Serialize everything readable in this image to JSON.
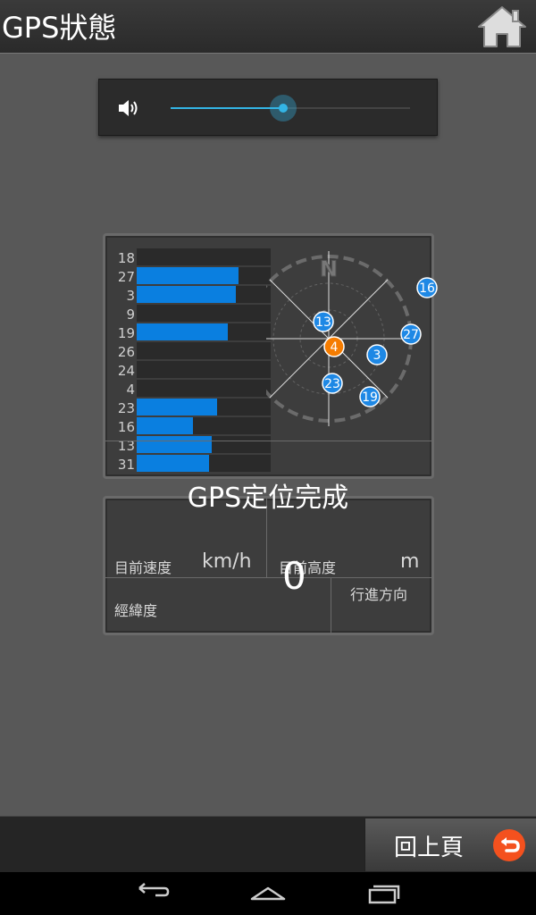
{
  "header": {
    "title": "GPS狀態",
    "home_icon": "home-icon"
  },
  "volume": {
    "level_percent": 47,
    "accent_color": "#33b5e5",
    "icon": "speaker-icon"
  },
  "satellites": {
    "bars": [
      {
        "id": "18",
        "strength": 0
      },
      {
        "id": "27",
        "strength": 76
      },
      {
        "id": "3",
        "strength": 74
      },
      {
        "id": "9",
        "strength": 0
      },
      {
        "id": "19",
        "strength": 68
      },
      {
        "id": "26",
        "strength": 0
      },
      {
        "id": "24",
        "strength": 0
      },
      {
        "id": "4",
        "strength": 0
      },
      {
        "id": "23",
        "strength": 60
      },
      {
        "id": "16",
        "strength": 42
      },
      {
        "id": "13",
        "strength": 56
      },
      {
        "id": "31",
        "strength": 54
      }
    ],
    "compass_north": "N",
    "sky_sats": [
      {
        "id": "13",
        "color": "#1e88e5"
      },
      {
        "id": "4",
        "color": "#f57c00"
      },
      {
        "id": "3",
        "color": "#1e88e5"
      },
      {
        "id": "23",
        "color": "#1e88e5"
      },
      {
        "id": "19",
        "color": "#1e88e5"
      },
      {
        "id": "27",
        "color": "#1e88e5"
      },
      {
        "id": "16",
        "color": "#1e88e5"
      }
    ]
  },
  "status": "GPS定位完成",
  "info": {
    "speed_label": "目前速度",
    "speed_unit": "km/h",
    "altitude_label": "目前高度",
    "altitude_unit": "m",
    "altitude_value": "0",
    "coords_label": "經緯度",
    "heading_label": "行進方向"
  },
  "footer": {
    "back_label": "回上頁",
    "back_icon": "undo-icon"
  },
  "navbar": {
    "back_icon": "nav-back-icon",
    "home_icon": "nav-home-icon",
    "recents_icon": "nav-recents-icon"
  }
}
